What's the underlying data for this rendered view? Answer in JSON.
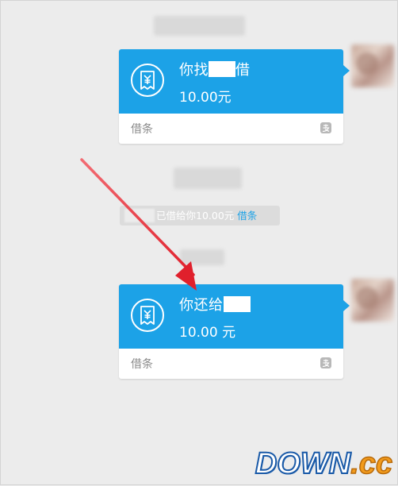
{
  "chat": {
    "messages": [
      {
        "title_prefix": "你找",
        "title_suffix": "借",
        "amount": "10.00元",
        "label": "借条"
      },
      {
        "title_prefix": "你还给",
        "title_suffix": "",
        "amount": "10.00 元",
        "label": "借条"
      }
    ],
    "system_notice": {
      "text": "已借给你10.00元",
      "link": "借条"
    }
  },
  "watermark": {
    "part1": "DOWN",
    "part2": ".cc"
  },
  "colors": {
    "accent": "#1ca2e7",
    "background": "#ececec",
    "arrow": "#e8323c"
  }
}
